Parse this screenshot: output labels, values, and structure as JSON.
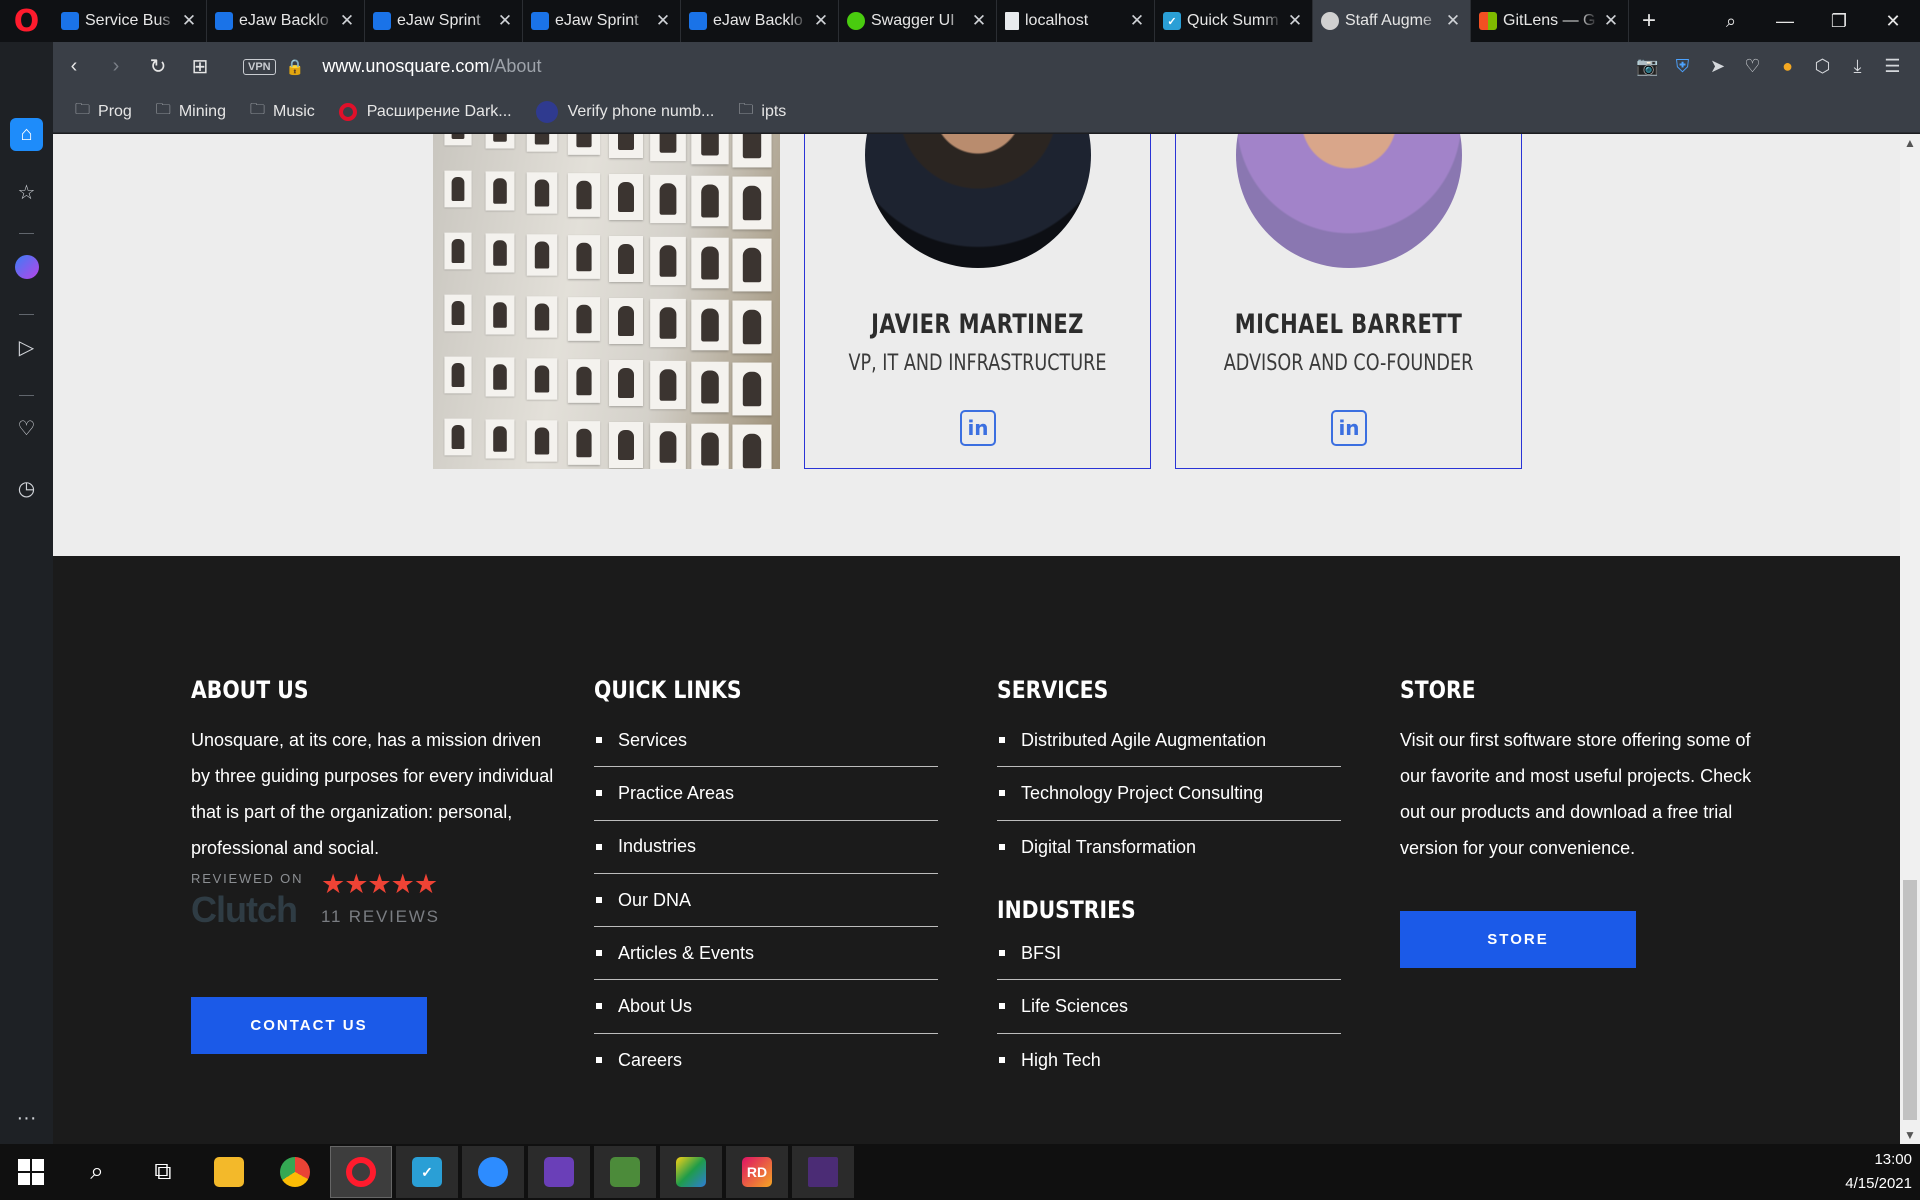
{
  "browser": {
    "tabs": [
      {
        "title": "Service Bus",
        "icon": "azure-devops-icon",
        "color": "#1a73e8"
      },
      {
        "title": "eJaw Backlo",
        "icon": "azure-devops-icon",
        "color": "#1a73e8"
      },
      {
        "title": "eJaw Sprint",
        "icon": "azure-devops-icon",
        "color": "#1a73e8"
      },
      {
        "title": "eJaw Sprint",
        "icon": "azure-devops-icon",
        "color": "#1a73e8"
      },
      {
        "title": "eJaw Backlo",
        "icon": "azure-devops-icon",
        "color": "#1a73e8"
      },
      {
        "title": "Swagger UI",
        "icon": "swagger-icon",
        "color": "#49cc0f"
      },
      {
        "title": "localhost",
        "icon": "page-icon",
        "color": "#9aa0a6"
      },
      {
        "title": "Quick Summ",
        "icon": "checkbox-icon",
        "color": "#2a9fd6"
      },
      {
        "title": "Staff Augme",
        "icon": "globe-icon",
        "color": "#d0d0d0",
        "active": true
      },
      {
        "title": "GitLens — G",
        "icon": "windows-icon",
        "color": "#f25022"
      }
    ],
    "url_domain": "www.unosquare.com",
    "url_path": "/About",
    "vpn_label": "VPN",
    "bookmarks": [
      {
        "label": "Prog",
        "icon": "folder-icon"
      },
      {
        "label": "Mining",
        "icon": "folder-icon"
      },
      {
        "label": "Music",
        "icon": "folder-icon"
      },
      {
        "label": "Расширение Dark...",
        "icon": "opera-addon-icon"
      },
      {
        "label": "Verify phone numb...",
        "icon": "send-icon"
      },
      {
        "label": "ipts",
        "icon": "folder-icon"
      }
    ]
  },
  "team": {
    "members": [
      {
        "name": "JAVIER MARTINEZ",
        "role": "VP, IT AND INFRASTRUCTURE"
      },
      {
        "name": "MICHAEL BARRETT",
        "role": "ADVISOR AND CO-FOUNDER"
      }
    ],
    "linkedin_label": "in"
  },
  "footer": {
    "about": {
      "heading": "ABOUT US",
      "text": "Unosquare, at its core, has a mission driven by three guiding purposes for every individual that is part of the organization: personal, professional and social.",
      "reviewed_on": "REVIEWED ON",
      "clutch_logo": "Clutch",
      "stars": "★★★★★",
      "reviews": "11 REVIEWS",
      "button": "CONTACT US"
    },
    "quick_links": {
      "heading": "QUICK LINKS",
      "items": [
        "Services",
        "Practice Areas",
        "Industries",
        "Our DNA",
        "Articles & Events",
        "About Us",
        "Careers"
      ]
    },
    "services": {
      "heading": "SERVICES",
      "items": [
        "Distributed Agile Augmentation",
        "Technology Project Consulting",
        "Digital Transformation"
      ]
    },
    "industries": {
      "heading": "INDUSTRIES",
      "items": [
        "BFSI",
        "Life Sciences",
        "High Tech"
      ]
    },
    "store": {
      "heading": "STORE",
      "text": "Visit our first software store offering some of our favorite and most useful projects. Check out our products and download a free trial version for your convenience.",
      "button": "STORE"
    }
  },
  "taskbar": {
    "time": "13:00",
    "date": "4/15/2021"
  },
  "colors": {
    "accent_blue": "#1b5ae8",
    "card_border": "#2a34d6",
    "star_red": "#ef4335",
    "footer_bg": "#1b1b1b"
  }
}
